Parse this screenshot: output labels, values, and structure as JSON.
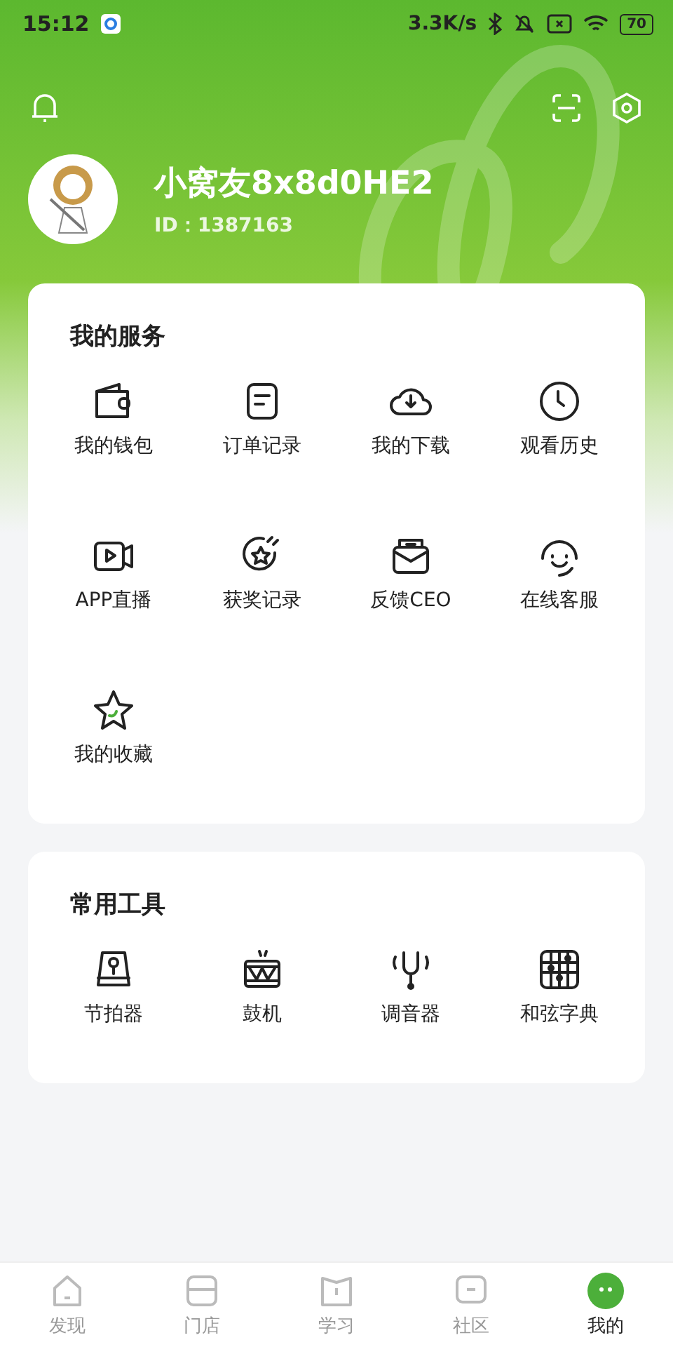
{
  "status_bar": {
    "time": "15:12",
    "speed": "3.3K/s",
    "battery": "70"
  },
  "profile": {
    "name": "小窝友8x8d0HE2",
    "id": "ID：1387163"
  },
  "services": {
    "title": "我的服务",
    "items": [
      {
        "label": "我的钱包",
        "kind": "wallet"
      },
      {
        "label": "订单记录",
        "kind": "note"
      },
      {
        "label": "我的下载",
        "kind": "download"
      },
      {
        "label": "观看历史",
        "kind": "clock"
      },
      {
        "label": "APP直播",
        "kind": "video"
      },
      {
        "label": "获奖记录",
        "kind": "award"
      },
      {
        "label": "反馈CEO",
        "kind": "mail"
      },
      {
        "label": "在线客服",
        "kind": "headset"
      },
      {
        "label": "我的收藏",
        "kind": "star"
      }
    ]
  },
  "tools": {
    "title": "常用工具",
    "items": [
      {
        "label": "节拍器",
        "kind": "metronome"
      },
      {
        "label": "鼓机",
        "kind": "drum"
      },
      {
        "label": "调音器",
        "kind": "fork"
      },
      {
        "label": "和弦字典",
        "kind": "chord"
      }
    ]
  },
  "tabs": [
    {
      "label": "发现",
      "kind": "home",
      "selected": false
    },
    {
      "label": "门店",
      "kind": "store",
      "selected": false
    },
    {
      "label": "学习",
      "kind": "book",
      "selected": false
    },
    {
      "label": "社区",
      "kind": "chat",
      "selected": false
    },
    {
      "label": "我的",
      "kind": "face",
      "selected": true
    }
  ]
}
